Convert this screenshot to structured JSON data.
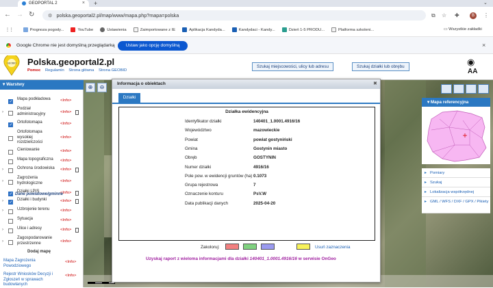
{
  "browser": {
    "tab_title": "GEOPORTAL 2",
    "url": "polska.geoportal2.pl/map/www/mapa.php?mapa=polska",
    "bookmarks": [
      "Prognoza pogody...",
      "YouTube",
      "Ustawienia",
      "Zaimportowane z IE",
      "Aplikacja Kandyda...",
      "Kandydaci - Kandy...",
      "Dzień 1-5 PRODU...",
      "Platforma szkoleni..."
    ],
    "all_bookmarks": "Wszystkie zakładki",
    "profile_initial": "B"
  },
  "infobar": {
    "message": "Google Chrome nie jest domyślną przeglądarką",
    "button": "Ustaw jako opcję domyślną"
  },
  "site": {
    "title": "Polska.geoportal2.pl",
    "links": [
      "Pomoc",
      "Regulamin",
      "Strona główna",
      "Strona GEOBID"
    ],
    "logo_text": "GEOBID",
    "search_place_button": "Szukaj miejscowości, ulicy lub adresu",
    "search_parcel_button": "Szukaj działki lub obrębu",
    "font_size_label": "AA"
  },
  "layers_panel": {
    "title": "Warstwy",
    "layers": [
      {
        "name": "Mapa podkładowa",
        "info": "<Info>",
        "checked": true,
        "expand": false,
        "doc": false
      },
      {
        "name": "Podział administracyjny",
        "info": "<Info>",
        "checked": false,
        "expand": true,
        "doc": true
      },
      {
        "name": "Ortofotomapa",
        "info": "<Info>",
        "checked": true,
        "expand": false,
        "doc": false
      },
      {
        "name": "Ortofotomapa wysokiej rozdzielczości",
        "info": "<Info>",
        "checked": false,
        "expand": false,
        "doc": false
      },
      {
        "name": "Cieniowanie",
        "info": "<Info>",
        "checked": false,
        "expand": false,
        "doc": false
      },
      {
        "name": "Mapa topograficzna",
        "info": "<Info>",
        "checked": false,
        "expand": false,
        "doc": false
      },
      {
        "name": "Ochrona środowiska",
        "info": "<Info>",
        "checked": false,
        "expand": true,
        "doc": true
      },
      {
        "name": "Zagrożenia hydrologiczne",
        "info": "<Info>",
        "checked": false,
        "expand": true,
        "doc": false
      },
      {
        "name": "Działki LPIS",
        "info": "<Info>",
        "checked": true,
        "expand": false,
        "doc": true
      }
    ],
    "section_label": "Dane powiatowe/gminne",
    "layers2": [
      {
        "name": "Działki i budynki",
        "info": "<Info>",
        "checked": true,
        "expand": true,
        "doc": true
      },
      {
        "name": "Uzbrojenie terenu",
        "info": "<Info>",
        "checked": false,
        "expand": true,
        "doc": false
      },
      {
        "name": "Sytuacja",
        "info": "<Info>",
        "checked": false,
        "expand": false,
        "doc": false
      },
      {
        "name": "Ulice i adresy",
        "info": "<Info>",
        "checked": false,
        "expand": true,
        "doc": true
      },
      {
        "name": "Zagospodarowanie przestrzenne",
        "info": "<Info>",
        "checked": false,
        "expand": true,
        "doc": false
      }
    ],
    "add_map": "Dodaj mapę",
    "map_links": [
      {
        "name": "Mapa Zagrożenia Powodziowego",
        "info": "<Info>"
      },
      {
        "name": "Rejestr Wniosków Decyzji i Zgłoszeń w sprawach budowlanych",
        "info": "<Info>"
      }
    ]
  },
  "dialog": {
    "title": "Informacja o obiektach",
    "tab": "Działki",
    "box_title": "Działka ewidencyjna",
    "rows": [
      {
        "k": "Identyfikator działki",
        "v": "140401_1.0001.4916/16"
      },
      {
        "k": "Województwo",
        "v": "mazowieckie"
      },
      {
        "k": "Powiat",
        "v": "powiat gostyniński"
      },
      {
        "k": "Gmina",
        "v": "Gostynin miasto"
      },
      {
        "k": "Obręb",
        "v": "GOSTYNIN"
      },
      {
        "k": "Numer działki",
        "v": "4916/16"
      },
      {
        "k": "Pole pow. w ewidencji gruntów (ha)",
        "v": "0.1073"
      },
      {
        "k": "Grupa rejestrowa",
        "v": "7"
      },
      {
        "k": "Oznaczenie konturu",
        "v": "PsV.W"
      },
      {
        "k": "Data publikacji danych",
        "v": "2025-04-20"
      }
    ],
    "colorize_label": "Zakoloruj:",
    "colors": [
      "#f28080",
      "#7fd17f",
      "#9a9af0",
      "#f7f25a"
    ],
    "remove_label": "Usuń zaznaczenia",
    "report_prefix": "Uzyskaj raport z wieloma informacjami dla działki ",
    "report_id": "140401_1.0001.4916/16",
    "report_suffix": " w serwisie OnGeo"
  },
  "right_panel": {
    "ref_title": "Mapa referencyjna",
    "accordion": [
      "Pomiary",
      "Szukaj",
      "Lokalizacja współrzędnej",
      "GML / WFS / DXF / GPX / Pikiety"
    ]
  }
}
